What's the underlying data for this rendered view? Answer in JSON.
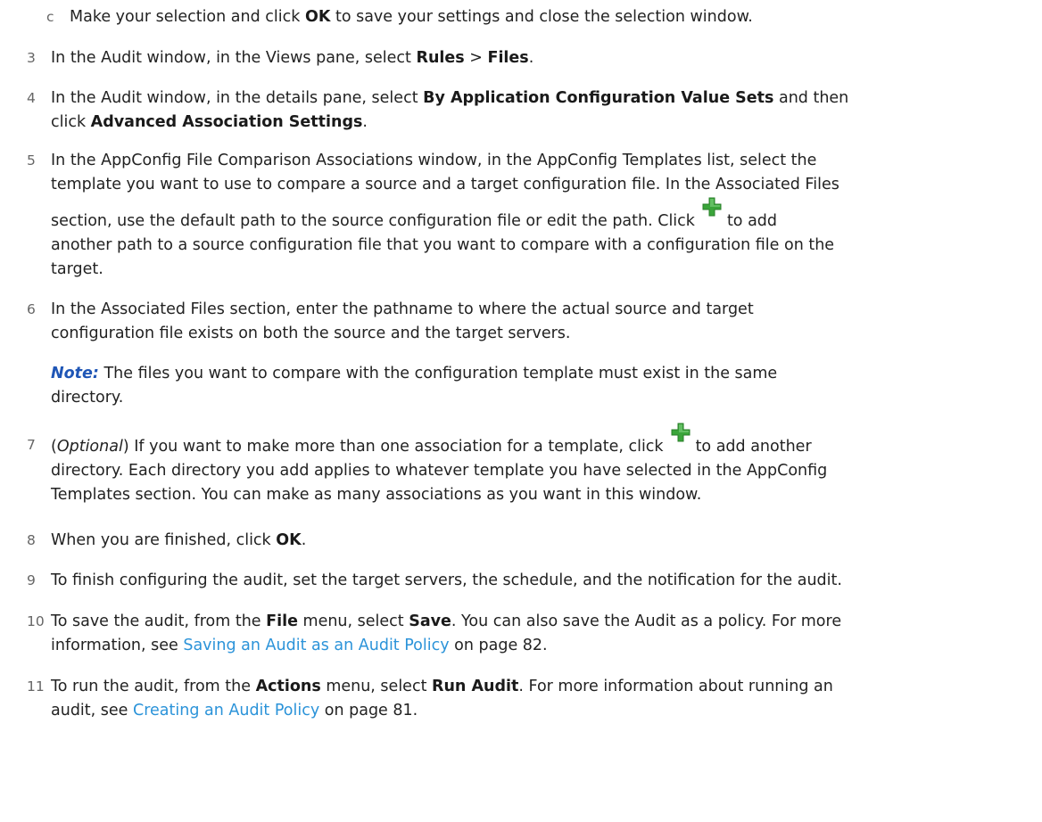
{
  "steps": [
    {
      "num": "c",
      "parts": [
        "Make your selection and click ",
        "OK",
        " to save your settings and close the selection window."
      ]
    },
    {
      "num": "3",
      "parts": [
        "In the Audit window, in the Views pane, select ",
        "Rules",
        " > ",
        "Files",
        "."
      ]
    },
    {
      "num": "4",
      "parts": [
        "In the Audit window, in the details pane, select ",
        "By Application Configuration Value Sets",
        " and then",
        "click ",
        "Advanced Association Settings",
        "."
      ]
    },
    {
      "num": "5",
      "lines": [
        "In the AppConfig File Comparison Associations window, in the AppConfig Templates list, select the",
        "template you want to use to compare a source and a target configuration file. In the Associated Files",
        "section, use the default path to the source configuration file or edit the path. Click",
        "to add",
        "another path to a source configuration file that you want to compare with a configuration file on the",
        "target."
      ]
    },
    {
      "num": "6",
      "lines": [
        "In the Associated Files section, enter the pathname to where the actual source and target",
        "configuration file exists on both the source and the target servers."
      ],
      "note_label": "Note:",
      "note_lines": [
        " The files you want to compare with the configuration template must exist in the same",
        "directory."
      ]
    },
    {
      "num": "7",
      "parts": [
        "(",
        "Optional",
        ") If you want to make more than one association for a template, click",
        "to add another",
        "directory. Each directory you add applies to whatever template you have selected in the AppConfig",
        "Templates section. You can make as many associations as you want in this window."
      ]
    },
    {
      "num": "8",
      "parts": [
        "When you are finished, click ",
        "OK",
        "."
      ]
    },
    {
      "num": "9",
      "parts": [
        "To finish configuring the audit, set the target servers, the schedule, and the notification for the audit."
      ]
    },
    {
      "num": "10",
      "parts": [
        "To save the audit, from the ",
        "File",
        " menu, select ",
        "Save",
        ". You can also save the Audit as a policy. For more",
        "information, see ",
        "Saving an Audit as an Audit Policy",
        " on page 82."
      ]
    },
    {
      "num": "11",
      "parts": [
        "To run the audit, from the ",
        "Actions",
        " menu, select ",
        "Run Audit",
        ". For more information about running an",
        "audit, see ",
        "Creating an Audit Policy",
        " on page 81."
      ]
    }
  ],
  "icons": {
    "add_icon_color": "#3aa53a",
    "link_color": "#2b93d9",
    "note_color": "#1f56b6"
  }
}
